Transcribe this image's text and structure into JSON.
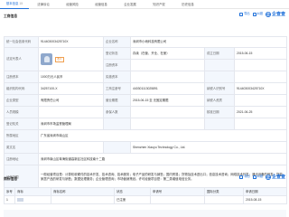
{
  "tabs": [
    {
      "label": "基本信息",
      "count": "15"
    },
    {
      "label": "法律诉讼",
      "count": ""
    },
    {
      "label": "经营风险",
      "count": ""
    },
    {
      "label": "经营信息",
      "count": ""
    },
    {
      "label": "企业发展",
      "count": ""
    },
    {
      "label": "知识产权",
      "count": ""
    },
    {
      "label": "历史信息",
      "count": ""
    }
  ],
  "business_section": {
    "title": "工商信息",
    "subtitle": "",
    "tool_labels": [
      "导出",
      "纠错"
    ],
    "brand_label": "企查查"
  },
  "business": {
    "rows": [
      {
        "l1": "统一社会信用代码",
        "v1": "914403003425710X",
        "l2": "企业名称",
        "v2": "深圳市小雨科技有限公司",
        "l3": "",
        "v3": ""
      },
      {
        "l1": "法定代表人",
        "v1": "",
        "l2": "登记状态",
        "v2": "存续（在营、开业、在册）",
        "l3": "成立日期",
        "v3": "2015-06-15"
      },
      {
        "l1": "",
        "v1": "",
        "l2": "注册资本",
        "v2": "",
        "l3": "",
        "v3": ""
      },
      {
        "l1": "注册资本",
        "v1": "1000万元人民币",
        "l2": "实缴资本",
        "v2": "",
        "l3": "",
        "v3": ""
      },
      {
        "l1": "组织机构代码",
        "v1": "34257100-X",
        "l2": "工商注册号",
        "v2": "440301113025891",
        "l3": "纳税人识别号",
        "v3": "914403003425710X"
      },
      {
        "l1": "企业类型",
        "v1": "有限责任公司",
        "l2": "营业期限",
        "v2": "2015-06-15 至 无固定期限",
        "l3": "纳税人资质",
        "v3": ""
      },
      {
        "l1": "人员规模",
        "v1": "",
        "l2": "参保人数",
        "v2": "",
        "l3": "核准日期",
        "v3": "2021-06-25"
      },
      {
        "l1": "登记机关",
        "v1": "深圳市市场监督管理局",
        "l2": "",
        "v2": "",
        "l3": "",
        "v3": ""
      },
      {
        "l1": "所属地区",
        "v1": "广东省深圳市南山区",
        "l2": "",
        "v2": "",
        "l3": "",
        "v3": ""
      },
      {
        "l1": "英文名",
        "v1": "",
        "l2": "",
        "v2": "Shenzhen Xiaoyu Technology Co., Ltd.",
        "l3": "",
        "v3": ""
      },
      {
        "l1": "注册地址",
        "v1": "深圳市南山区粤海街道高新区社区科技南十二路",
        "l2": "",
        "v2": "",
        "l3": "",
        "v3": ""
      }
    ],
    "legal_rep": {
      "name": "",
      "tag": "法人"
    },
    "scope_label": "经营范围",
    "scope_text": "一般经营项目是：计算机软硬件的技术开发、技术咨询、技术服务；电子产品的研发与销售；国内贸易；货物及技术进出口；信息技术咨询；网络技术开发；通讯设备的研发；智能家居产品的研发与销售；数据处理服务；企业管理咨询；市场营销策划。许可经营项目是：第二类增值电信业务。"
  },
  "ip_section": {
    "title": "商标信息",
    "subtitle": "",
    "tool_labels": [
      "导出",
      "纠错"
    ],
    "brand_label": "企查查"
  },
  "ip_table": {
    "headers": [
      "序号",
      "商标",
      "商标名称",
      "状态",
      "申请号",
      "国际分类",
      "申请日期"
    ],
    "rows": [
      [
        "1",
        "",
        "",
        "已注册",
        "",
        "",
        "2015-08-15"
      ]
    ]
  }
}
